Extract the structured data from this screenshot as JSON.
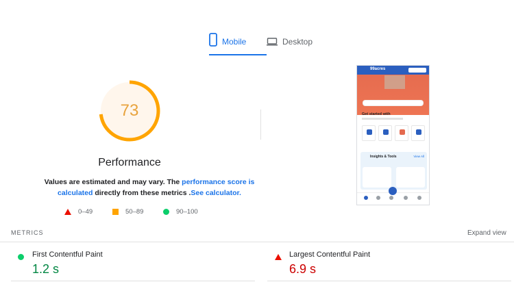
{
  "tabs": {
    "mobile_label": "Mobile",
    "desktop_label": "Desktop",
    "active": "mobile"
  },
  "performance": {
    "score": "73",
    "score_fraction": 0.73,
    "title": "Performance",
    "note_prefix": "Values are estimated and may vary. The ",
    "note_link1": "performance score is calculated",
    "note_middle": " directly from these metrics .",
    "note_link2": "See calculator."
  },
  "legend": {
    "poor": "0–49",
    "average": "50–89",
    "good": "90–100"
  },
  "screenshot": {
    "brand": "99acres"
  },
  "metrics": {
    "header": "METRICS",
    "expand_label": "Expand view",
    "items": [
      {
        "name": "First Contentful Paint",
        "value": "1.2 s",
        "status": "good"
      },
      {
        "name": "Largest Contentful Paint",
        "value": "6.9 s",
        "status": "poor"
      }
    ]
  },
  "colors": {
    "accent": "#1a73e8",
    "average": "#ffa400",
    "poor": "#eb0f00",
    "good": "#0cce6b",
    "good_text": "#018642",
    "poor_text": "#cc0000"
  }
}
